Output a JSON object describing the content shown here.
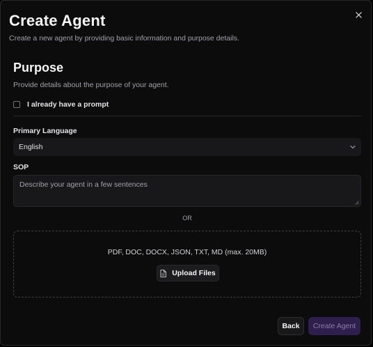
{
  "dialog": {
    "title": "Create Agent",
    "subtitle": "Create a new agent by providing basic information and purpose details.",
    "close_icon": "close-icon"
  },
  "purpose": {
    "title": "Purpose",
    "description": "Provide details about the purpose of your agent.",
    "prompt_checkbox_label": "I already have a prompt",
    "prompt_checkbox_checked": false
  },
  "language": {
    "label": "Primary Language",
    "value": "English"
  },
  "sop": {
    "label": "SOP",
    "placeholder": "Describe your agent in a few sentences",
    "value": ""
  },
  "separator_text": "OR",
  "upload": {
    "formats_text": "PDF, DOC, DOCX, JSON, TXT, MD (max. 20MB)",
    "button_label": "Upload Files",
    "icon": "file-icon"
  },
  "footer": {
    "back_label": "Back",
    "create_label": "Create Agent",
    "create_disabled": true
  },
  "colors": {
    "background": "#0c0c0d",
    "input_background": "#18181b",
    "accent_disabled": "#2e1f4f"
  }
}
